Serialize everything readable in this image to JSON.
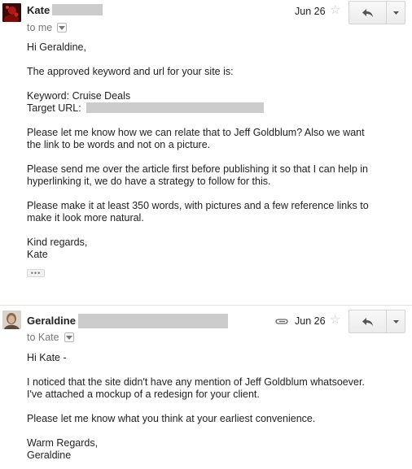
{
  "messages": [
    {
      "sender": "Kate",
      "to_label": "to me",
      "date": "Jun 26",
      "has_attachment": false,
      "greeting": "Hi Geraldine,",
      "intro": "The approved keyword and url for your site is:",
      "keyword_line": "Keyword: Cruise Deals",
      "target_url_label": "Target URL:",
      "p1_line1": "Please let me know how we can relate that to Jeff Goldblum? Also we want",
      "p1_line2": "the link to be words and not on a picture.",
      "p2_line1": "Please send me over the article first before publishing it so that I can help in",
      "p2_line2": "hyperlinking it, we do have a strategy to follow for this.",
      "p3_line1": "Please make it at least 350 words, with pictures and a few reference links to",
      "p3_line2": "make it look more natural.",
      "closing": "Kind regards,",
      "signature": "Kate",
      "trimmed_content": "•••"
    },
    {
      "sender": "Geraldine",
      "to_label": "to Kate",
      "date": "Jun 26",
      "has_attachment": true,
      "greeting": "Hi Kate -",
      "p1_line1": "I noticed that the site didn't have any mention of Jeff Goldblum whatsoever.",
      "p1_line2": "I've attached a mockup of a redesign for your client.",
      "p2_line1": "Please let me know what you think at your earliest convenience.",
      "closing": "Warm Regards,",
      "signature": "Geraldine"
    }
  ],
  "icons": {
    "star": "star-outline-icon",
    "reply": "reply-arrow-icon",
    "more": "dropdown-caret-icon",
    "attachment": "paperclip-icon"
  },
  "colors": {
    "redaction": "#cccccc",
    "star": "#c7c7c7",
    "secondary_text": "#777777"
  }
}
